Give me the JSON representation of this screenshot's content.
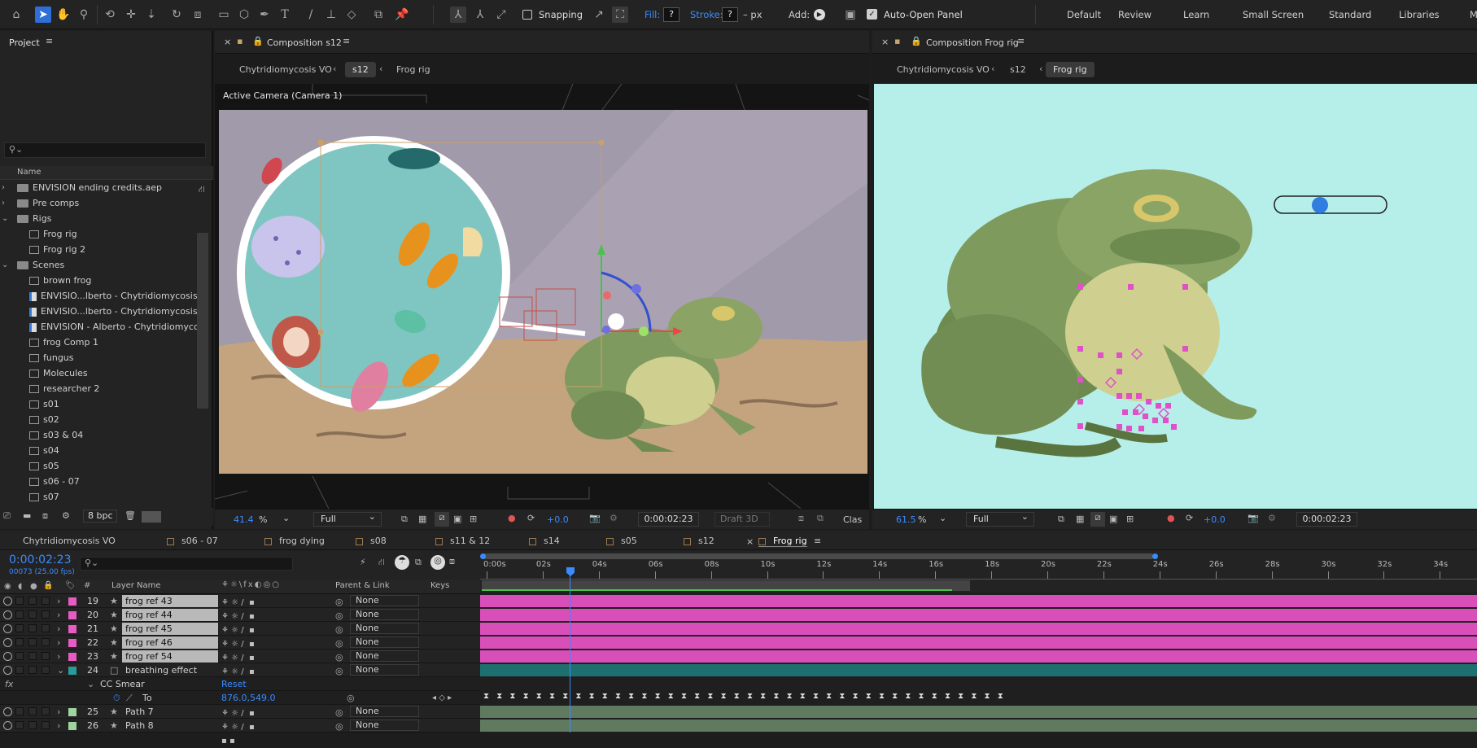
{
  "toolbar": {
    "snapping_label": "Snapping",
    "fill_label": "Fill:",
    "fill_value": "?",
    "stroke_label": "Stroke:",
    "stroke_value": "?",
    "stroke_px": "– px",
    "add_label": "Add:",
    "auto_open_label": "Auto-Open Panel",
    "workspaces": [
      "Default",
      "Review",
      "Learn",
      "Small Screen",
      "Standard",
      "Libraries",
      "M"
    ],
    "icons": [
      "home-icon",
      "selection-tool-icon",
      "hand-tool-icon",
      "zoom-tool-icon",
      "orbit-camera-icon",
      "pan-camera-icon",
      "dolly-camera-icon",
      "rotate-tool-icon",
      "pan-behind-icon",
      "rectangle-tool-icon",
      "cube-tool-icon",
      "pen-tool-icon",
      "type-tool-icon",
      "brush-tool-icon",
      "clone-stamp-icon",
      "eraser-icon",
      "roto-brush-icon",
      "puppet-pin-icon"
    ]
  },
  "project": {
    "title": "Project",
    "column_name": "Name",
    "bpc": "8 bpc",
    "items": [
      {
        "label": "ENVISION ending credits.aep",
        "type": "folder",
        "indent": 0,
        "expander": ">"
      },
      {
        "label": "Pre comps",
        "type": "folder",
        "indent": 0,
        "expander": ">"
      },
      {
        "label": "Rigs",
        "type": "folder",
        "indent": 0,
        "expander": "v"
      },
      {
        "label": "Frog rig",
        "type": "comp",
        "indent": 1,
        "expander": ""
      },
      {
        "label": "Frog rig 2",
        "type": "comp",
        "indent": 1,
        "expander": ""
      },
      {
        "label": "Scenes",
        "type": "folder",
        "indent": 0,
        "expander": "v"
      },
      {
        "label": "brown frog",
        "type": "comp",
        "indent": 1,
        "expander": ""
      },
      {
        "label": "ENVISIO...lberto - Chytridiomycosis - illu",
        "type": "file",
        "indent": 1,
        "expander": ""
      },
      {
        "label": "ENVISIO...lberto - Chytridiomycosis - illu",
        "type": "file",
        "indent": 1,
        "expander": ""
      },
      {
        "label": "ENVISION - Alberto - Chytridiomycosis-",
        "type": "file",
        "indent": 1,
        "expander": ""
      },
      {
        "label": "frog Comp 1",
        "type": "comp",
        "indent": 1,
        "expander": ""
      },
      {
        "label": "fungus",
        "type": "comp",
        "indent": 1,
        "expander": ""
      },
      {
        "label": "Molecules",
        "type": "comp",
        "indent": 1,
        "expander": ""
      },
      {
        "label": "researcher 2",
        "type": "comp",
        "indent": 1,
        "expander": ""
      },
      {
        "label": "s01",
        "type": "comp",
        "indent": 1,
        "expander": ""
      },
      {
        "label": "s02",
        "type": "comp",
        "indent": 1,
        "expander": ""
      },
      {
        "label": "s03 & 04",
        "type": "comp",
        "indent": 1,
        "expander": ""
      },
      {
        "label": "s04",
        "type": "comp",
        "indent": 1,
        "expander": ""
      },
      {
        "label": "s05",
        "type": "comp",
        "indent": 1,
        "expander": ""
      },
      {
        "label": "s06 - 07",
        "type": "comp",
        "indent": 1,
        "expander": ""
      },
      {
        "label": "s07",
        "type": "comp",
        "indent": 1,
        "expander": ""
      }
    ]
  },
  "comp_left": {
    "tab_title": "Composition s12",
    "breadcrumbs": [
      "Chytridiomycosis VO",
      "s12",
      "Frog rig"
    ],
    "active_breadcrumb": 1,
    "camera_label": "Active Camera (Camera 1)",
    "zoom": "41.4",
    "zoom_unit": "%",
    "resolution": "Full",
    "exposure": "+0.0",
    "timecode": "0:00:02:23",
    "renderer": "Draft 3D",
    "extra": "Clas"
  },
  "comp_right": {
    "tab_title": "Composition Frog rig",
    "breadcrumbs": [
      "Chytridiomycosis VO",
      "s12",
      "Frog rig"
    ],
    "active_breadcrumb": 2,
    "zoom": "61.5",
    "zoom_unit": "%",
    "resolution": "Full",
    "exposure": "+0.0",
    "timecode": "0:00:02:23"
  },
  "timeline": {
    "tabs": [
      "Chytridiomycosis VO",
      "s06 - 07",
      "frog dying",
      "s08",
      "s11 & 12",
      "s14",
      "s05",
      "s12",
      "Frog rig"
    ],
    "active_tab": "Frog rig",
    "current_time": "0:00:02:23",
    "frame_info": "00073 (25.00 fps)",
    "col_layer_name": "Layer Name",
    "col_parent": "Parent & Link",
    "col_keys": "Keys",
    "col_num": "#",
    "ruler": [
      "0:00s",
      "02s",
      "04s",
      "06s",
      "08s",
      "10s",
      "12s",
      "14s",
      "16s",
      "18s",
      "20s",
      "22s",
      "24s",
      "26s",
      "28s",
      "30s",
      "32s",
      "34s"
    ],
    "layers": [
      {
        "num": "19",
        "name": "frog ref 43",
        "color": "#e85ac4",
        "parent": "None"
      },
      {
        "num": "20",
        "name": "frog ref 44",
        "color": "#e85ac4",
        "parent": "None"
      },
      {
        "num": "21",
        "name": "frog ref 45",
        "color": "#e85ac4",
        "parent": "None"
      },
      {
        "num": "22",
        "name": "frog ref 46",
        "color": "#e85ac4",
        "parent": "None"
      },
      {
        "num": "23",
        "name": "frog ref 54",
        "color": "#e85ac4",
        "parent": "None"
      },
      {
        "num": "24",
        "name": "breathing effect",
        "color": "#2a9a9a",
        "parent": "None"
      }
    ],
    "effect_name": "CC Smear",
    "effect_reset": "Reset",
    "prop_name": "To",
    "prop_value": "876.0,549.0",
    "layers_after": [
      {
        "num": "25",
        "name": "Path 7",
        "color": "#9fd39f",
        "parent": "None"
      },
      {
        "num": "26",
        "name": "Path 8",
        "color": "#9fd39f",
        "parent": "None"
      }
    ]
  }
}
